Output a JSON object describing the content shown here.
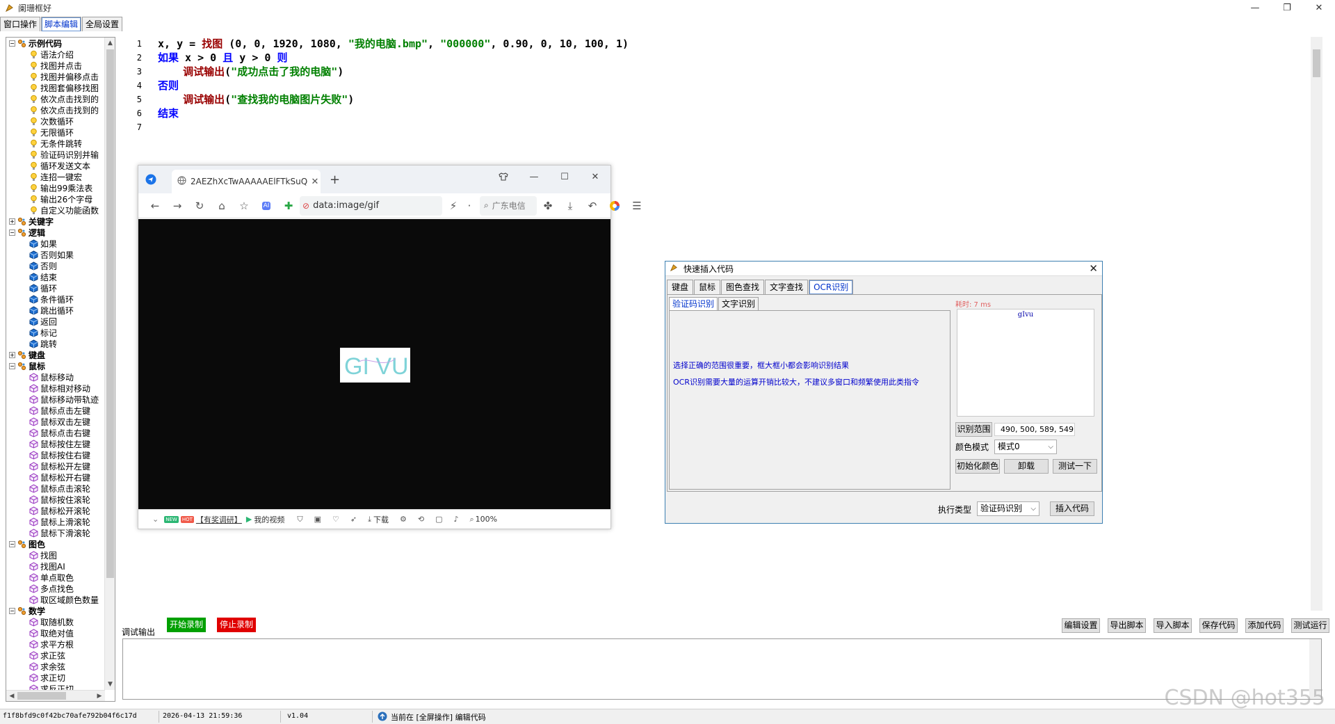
{
  "window": {
    "title": "阑珊框好",
    "minimize": "—",
    "maximize": "❐",
    "close": "✕"
  },
  "menu_tabs": [
    "窗口操作",
    "脚本编辑",
    "全局设置"
  ],
  "tree": [
    {
      "type": "cat",
      "expanded": true,
      "label": "示例代码",
      "icon": "folder-gear-icon"
    },
    {
      "type": "item",
      "icon": "bulb-icon",
      "label": "语法介绍"
    },
    {
      "type": "item",
      "icon": "bulb-icon",
      "label": "找图并点击"
    },
    {
      "type": "item",
      "icon": "bulb-icon",
      "label": "找图并偏移点击"
    },
    {
      "type": "item",
      "icon": "bulb-icon",
      "label": "找图套偏移找图"
    },
    {
      "type": "item",
      "icon": "bulb-icon",
      "label": "依次点击找到的"
    },
    {
      "type": "item",
      "icon": "bulb-icon",
      "label": "依次点击找到的"
    },
    {
      "type": "item",
      "icon": "bulb-icon",
      "label": "次数循环"
    },
    {
      "type": "item",
      "icon": "bulb-icon",
      "label": "无限循环"
    },
    {
      "type": "item",
      "icon": "bulb-icon",
      "label": "无条件跳转"
    },
    {
      "type": "item",
      "icon": "bulb-icon",
      "label": "验证码识别并输"
    },
    {
      "type": "item",
      "icon": "bulb-icon",
      "label": "循环发送文本"
    },
    {
      "type": "item",
      "icon": "bulb-icon",
      "label": "连招一键宏"
    },
    {
      "type": "item",
      "icon": "bulb-icon",
      "label": "输出99乘法表"
    },
    {
      "type": "item",
      "icon": "bulb-icon",
      "label": "输出26个字母"
    },
    {
      "type": "item",
      "icon": "bulb-icon",
      "label": "自定义功能函数"
    },
    {
      "type": "cat",
      "expanded": false,
      "label": "关键字",
      "icon": "folder-gear-icon"
    },
    {
      "type": "cat",
      "expanded": true,
      "label": "逻辑",
      "icon": "folder-gear-icon"
    },
    {
      "type": "item",
      "icon": "cube-blue-icon",
      "label": "如果"
    },
    {
      "type": "item",
      "icon": "cube-blue-icon",
      "label": "否则如果"
    },
    {
      "type": "item",
      "icon": "cube-blue-icon",
      "label": "否则"
    },
    {
      "type": "item",
      "icon": "cube-blue-icon",
      "label": "结束"
    },
    {
      "type": "item",
      "icon": "cube-blue-icon",
      "label": "循环"
    },
    {
      "type": "item",
      "icon": "cube-blue-icon",
      "label": "条件循环"
    },
    {
      "type": "item",
      "icon": "cube-blue-icon",
      "label": "跳出循环"
    },
    {
      "type": "item",
      "icon": "cube-blue-icon",
      "label": "返回"
    },
    {
      "type": "item",
      "icon": "cube-blue-icon",
      "label": "标记"
    },
    {
      "type": "item",
      "icon": "cube-blue-icon",
      "label": "跳转"
    },
    {
      "type": "cat",
      "expanded": false,
      "label": "键盘",
      "icon": "folder-gear-icon"
    },
    {
      "type": "cat",
      "expanded": true,
      "label": "鼠标",
      "icon": "folder-gear-icon"
    },
    {
      "type": "item",
      "icon": "cube-purple-icon",
      "label": "鼠标移动"
    },
    {
      "type": "item",
      "icon": "cube-purple-icon",
      "label": "鼠标相对移动"
    },
    {
      "type": "item",
      "icon": "cube-purple-icon",
      "label": "鼠标移动带轨迹"
    },
    {
      "type": "item",
      "icon": "cube-purple-icon",
      "label": "鼠标点击左键"
    },
    {
      "type": "item",
      "icon": "cube-purple-icon",
      "label": "鼠标双击左键"
    },
    {
      "type": "item",
      "icon": "cube-purple-icon",
      "label": "鼠标点击右键"
    },
    {
      "type": "item",
      "icon": "cube-purple-icon",
      "label": "鼠标按住左键"
    },
    {
      "type": "item",
      "icon": "cube-purple-icon",
      "label": "鼠标按住右键"
    },
    {
      "type": "item",
      "icon": "cube-purple-icon",
      "label": "鼠标松开左键"
    },
    {
      "type": "item",
      "icon": "cube-purple-icon",
      "label": "鼠标松开右键"
    },
    {
      "type": "item",
      "icon": "cube-purple-icon",
      "label": "鼠标点击滚轮"
    },
    {
      "type": "item",
      "icon": "cube-purple-icon",
      "label": "鼠标按住滚轮"
    },
    {
      "type": "item",
      "icon": "cube-purple-icon",
      "label": "鼠标松开滚轮"
    },
    {
      "type": "item",
      "icon": "cube-purple-icon",
      "label": "鼠标上滑滚轮"
    },
    {
      "type": "item",
      "icon": "cube-purple-icon",
      "label": "鼠标下滑滚轮"
    },
    {
      "type": "cat",
      "expanded": true,
      "label": "图色",
      "icon": "folder-gear-icon"
    },
    {
      "type": "item",
      "icon": "cube-purple-icon",
      "label": "找图"
    },
    {
      "type": "item",
      "icon": "cube-purple-icon",
      "label": "找图AI"
    },
    {
      "type": "item",
      "icon": "cube-purple-icon",
      "label": "单点取色"
    },
    {
      "type": "item",
      "icon": "cube-purple-icon",
      "label": "多点找色"
    },
    {
      "type": "item",
      "icon": "cube-purple-icon",
      "label": "取区域颜色数量"
    },
    {
      "type": "cat",
      "expanded": true,
      "label": "数学",
      "icon": "folder-gear-icon"
    },
    {
      "type": "item",
      "icon": "cube-purple-icon",
      "label": "取随机数"
    },
    {
      "type": "item",
      "icon": "cube-purple-icon",
      "label": "取绝对值"
    },
    {
      "type": "item",
      "icon": "cube-purple-icon",
      "label": "求平方根"
    },
    {
      "type": "item",
      "icon": "cube-purple-icon",
      "label": "求正弦"
    },
    {
      "type": "item",
      "icon": "cube-purple-icon",
      "label": "求余弦"
    },
    {
      "type": "item",
      "icon": "cube-purple-icon",
      "label": "求正切"
    },
    {
      "type": "item",
      "icon": "cube-purple-icon",
      "label": "求反正切"
    }
  ],
  "editor": {
    "line_numbers": [
      "1",
      "2",
      "3",
      "4",
      "5",
      "6",
      "7"
    ],
    "lines": [
      [
        {
          "c": "pl",
          "t": "x, y = "
        },
        {
          "c": "fn",
          "t": "找图"
        },
        {
          "c": "pl",
          "t": " (0, 0, 1920, 1080, "
        },
        {
          "c": "str",
          "t": "\"我的电脑.bmp\""
        },
        {
          "c": "pl",
          "t": ", "
        },
        {
          "c": "str",
          "t": "\"000000\""
        },
        {
          "c": "pl",
          "t": ", 0.90, 0, 10, 100, 1)"
        }
      ],
      [
        {
          "c": "kw",
          "t": "如果"
        },
        {
          "c": "pl",
          "t": " x > 0 "
        },
        {
          "c": "kw",
          "t": "且"
        },
        {
          "c": "pl",
          "t": " y > 0 "
        },
        {
          "c": "kw",
          "t": "则"
        }
      ],
      [
        {
          "c": "pl",
          "t": "    "
        },
        {
          "c": "fn",
          "t": "调试输出"
        },
        {
          "c": "pl",
          "t": "("
        },
        {
          "c": "str",
          "t": "\"成功点击了我的电脑\""
        },
        {
          "c": "pl",
          "t": ")"
        }
      ],
      [
        {
          "c": "kw",
          "t": "否则"
        }
      ],
      [
        {
          "c": "pl",
          "t": "    "
        },
        {
          "c": "fn",
          "t": "调试输出"
        },
        {
          "c": "pl",
          "t": "("
        },
        {
          "c": "str",
          "t": "\"查找我的电脑图片失败\""
        },
        {
          "c": "pl",
          "t": ")"
        }
      ],
      [
        {
          "c": "kw",
          "t": "结束"
        }
      ],
      []
    ]
  },
  "browser": {
    "tab_title": "2AEZhXcTwAAAAAElFTkSuQ",
    "tab_close": "✕",
    "new_tab": "+",
    "address": "data:image/gif",
    "search_placeholder": "广东电信",
    "captcha_text": "GI VU",
    "status_new": "NEW",
    "status_hot": "HOT",
    "status_promo": "【有奖调研】",
    "status_video": "我的视频",
    "status_download": "下载",
    "zoom": "100%"
  },
  "dialog": {
    "title": "快速插入代码",
    "tabs": [
      "键盘",
      "鼠标",
      "图色查找",
      "文字查找",
      "OCR识别"
    ],
    "active_tab": 4,
    "subtabs": [
      "验证码识别",
      "文字识别"
    ],
    "info1": "选择正确的范围很重要，框大框小都会影响识别结果",
    "info2": "OCR识别需要大量的运算开销比较大，不建议多窗口和频繁使用此类指令",
    "elapsed": "耗时: 7 ms",
    "result": "gIvu",
    "range_button": "识别范围",
    "range_value": "490, 500, 589, 549",
    "color_mode_label": "颜色模式",
    "color_mode_value": "模式0",
    "init_color": "初始化颜色",
    "unload": "卸载",
    "test": "测试一下",
    "exec_type_label": "执行类型",
    "exec_type_value": "验证码识别",
    "insert": "插入代码"
  },
  "debug": {
    "label": "调试输出",
    "start_record": "开始录制",
    "stop_record": "停止录制",
    "buttons": [
      "编辑设置",
      "导出脚本",
      "导入脚本",
      "保存代码",
      "添加代码",
      "测试运行"
    ]
  },
  "statusbar": {
    "hash": "f1f8bfd9c0f42bc70afe792b04f6c17d",
    "datetime": "2026-04-13 21:59:36",
    "version": "v1.04",
    "state": "当前在 [全屏操作] 编辑代码"
  },
  "watermark": "CSDN @hot355",
  "colors": {
    "accent": "#0033cc",
    "keyword": "#0000ff",
    "function": "#990000",
    "string": "#008000",
    "start_record": "#00a000",
    "stop_record": "#e00000",
    "info_text": "#0000cc",
    "elapsed_text": "#e06060"
  }
}
